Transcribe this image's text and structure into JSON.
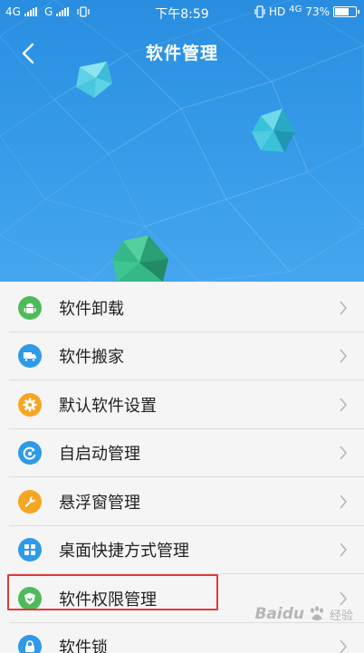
{
  "status_bar": {
    "network_1": "4G",
    "network_2": "G",
    "time": "下午8:59",
    "hd": "HD",
    "network_3": "4G",
    "battery_percent": "73%",
    "battery_level": 0.73
  },
  "header": {
    "title": "软件管理",
    "back_icon": "chevron-left-icon",
    "background_color": "#3399e8"
  },
  "menu": {
    "items": [
      {
        "label": "软件卸载",
        "icon": "android-icon",
        "color": "#4dbb5a"
      },
      {
        "label": "软件搬家",
        "icon": "truck-icon",
        "color": "#2f9ae8"
      },
      {
        "label": "默认软件设置",
        "icon": "gear-icon",
        "color": "#f5a623"
      },
      {
        "label": "自启动管理",
        "icon": "power-cycle-icon",
        "color": "#2f9ae8"
      },
      {
        "label": "悬浮窗管理",
        "icon": "wrench-icon",
        "color": "#f5a623"
      },
      {
        "label": "桌面快捷方式管理",
        "icon": "grid-icon",
        "color": "#2f9ae8"
      },
      {
        "label": "软件权限管理",
        "icon": "shield-icon",
        "color": "#4dbb5a"
      },
      {
        "label": "软件锁",
        "icon": "lock-icon",
        "color": "#2f9ae8"
      }
    ],
    "highlighted_index": 6,
    "highlight_color": "#e03a3a"
  },
  "watermark": {
    "text": "Baidu",
    "subtext": "经验"
  }
}
